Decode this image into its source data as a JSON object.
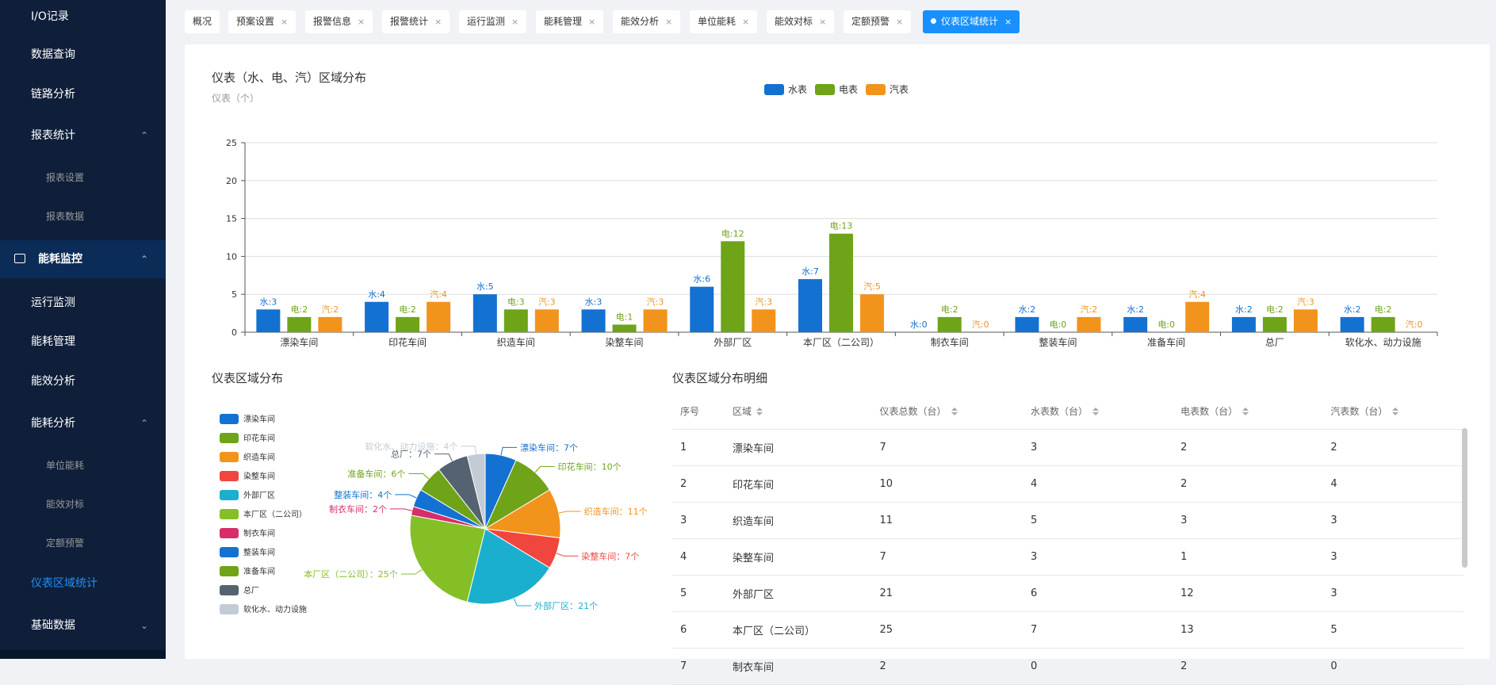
{
  "sidebar": {
    "items": [
      {
        "label": "I/O记录",
        "kind": "top"
      },
      {
        "label": "数据查询",
        "kind": "top"
      },
      {
        "label": "链路分析",
        "kind": "top"
      },
      {
        "label": "报表统计",
        "kind": "top",
        "chevron": "⌃"
      },
      {
        "label": "报表设置",
        "kind": "sub"
      },
      {
        "label": "报表数据",
        "kind": "sub"
      },
      {
        "label": "能耗监控",
        "kind": "group",
        "chevron": "⌃"
      },
      {
        "label": "运行监测",
        "kind": "top"
      },
      {
        "label": "能耗管理",
        "kind": "top"
      },
      {
        "label": "能效分析",
        "kind": "top"
      },
      {
        "label": "能耗分析",
        "kind": "top",
        "chevron": "⌃"
      },
      {
        "label": "单位能耗",
        "kind": "sub"
      },
      {
        "label": "能效对标",
        "kind": "sub"
      },
      {
        "label": "定额预警",
        "kind": "sub"
      },
      {
        "label": "仪表区域统计",
        "kind": "current"
      },
      {
        "label": "基础数据",
        "kind": "top",
        "chevron": "⌄"
      }
    ]
  },
  "tabs": [
    {
      "label": "概况",
      "closable": false
    },
    {
      "label": "预案设置",
      "closable": true
    },
    {
      "label": "报警信息",
      "closable": true
    },
    {
      "label": "报警统计",
      "closable": true
    },
    {
      "label": "运行监测",
      "closable": true
    },
    {
      "label": "能耗管理",
      "closable": true
    },
    {
      "label": "能效分析",
      "closable": true
    },
    {
      "label": "单位能耗",
      "closable": true
    },
    {
      "label": "能效对标",
      "closable": true
    },
    {
      "label": "定额预警",
      "closable": true
    },
    {
      "label": "仪表区域统计",
      "closable": true,
      "active": true
    }
  ],
  "tab_close_glyph": "×",
  "bar_section": {
    "title": "仪表（水、电、汽）区域分布",
    "subtitle": "仪表（个）"
  },
  "pie_section": {
    "title": "仪表区域分布"
  },
  "table_section": {
    "title": "仪表区域分布明细"
  },
  "colors": {
    "water": "#1371d1",
    "electric": "#6fa318",
    "steam": "#f2931c",
    "accent": "#1890ff",
    "sidebar_bg": "#0f1f3a"
  },
  "chart_data": [
    {
      "type": "bar",
      "title": "仪表（水、电、汽）区域分布",
      "ylabel": "仪表（个）",
      "ylim": [
        0,
        25
      ],
      "yticks": [
        0,
        5,
        10,
        15,
        20,
        25
      ],
      "grid": true,
      "legend_position": "top-center",
      "categories": [
        "漂染车间",
        "印花车间",
        "织造车间",
        "染整车间",
        "外部厂区",
        "本厂区（二公司）",
        "制衣车间",
        "整装车间",
        "准备车间",
        "总厂",
        "软化水、动力设施"
      ],
      "series": [
        {
          "name": "水表",
          "prefix": "水:",
          "color": "#1371d1",
          "values": [
            3,
            4,
            5,
            3,
            6,
            7,
            0,
            2,
            2,
            2,
            2
          ]
        },
        {
          "name": "电表",
          "prefix": "电:",
          "color": "#6fa318",
          "values": [
            2,
            2,
            3,
            1,
            12,
            13,
            2,
            0,
            0,
            2,
            2
          ]
        },
        {
          "name": "汽表",
          "prefix": "汽:",
          "color": "#f2931c",
          "values": [
            2,
            4,
            3,
            3,
            3,
            5,
            0,
            2,
            4,
            3,
            0
          ]
        }
      ]
    },
    {
      "type": "pie",
      "title": "仪表区域分布",
      "legend_position": "left",
      "unit": "个",
      "slices": [
        {
          "name": "漂染车间",
          "value": 7,
          "color": "#1371d1"
        },
        {
          "name": "印花车间",
          "value": 10,
          "color": "#6fa318"
        },
        {
          "name": "织造车间",
          "value": 11,
          "color": "#f2931c"
        },
        {
          "name": "染整车间",
          "value": 7,
          "color": "#f0463e"
        },
        {
          "name": "外部厂区",
          "value": 21,
          "color": "#1aafcf"
        },
        {
          "name": "本厂区（二公司）",
          "value": 25,
          "color": "#85bf26"
        },
        {
          "name": "制衣车间",
          "value": 2,
          "color": "#d72d6b"
        },
        {
          "name": "整装车间",
          "value": 4,
          "color": "#1371d1"
        },
        {
          "name": "准备车间",
          "value": 6,
          "color": "#6fa318"
        },
        {
          "name": "总厂",
          "value": 7,
          "color": "#556270"
        },
        {
          "name": "软化水、动力设施",
          "value": 4,
          "color": "#c3ccd6"
        }
      ]
    }
  ],
  "table": {
    "headers": [
      "序号",
      "区域",
      "仪表总数（台）",
      "水表数（台）",
      "电表数（台）",
      "汽表数（台）"
    ],
    "rows": [
      [
        "1",
        "漂染车间",
        "7",
        "3",
        "2",
        "2"
      ],
      [
        "2",
        "印花车间",
        "10",
        "4",
        "2",
        "4"
      ],
      [
        "3",
        "织造车间",
        "11",
        "5",
        "3",
        "3"
      ],
      [
        "4",
        "染整车间",
        "7",
        "3",
        "1",
        "3"
      ],
      [
        "5",
        "外部厂区",
        "21",
        "6",
        "12",
        "3"
      ],
      [
        "6",
        "本厂区（二公司）",
        "25",
        "7",
        "13",
        "5"
      ],
      [
        "7",
        "制衣车间",
        "2",
        "0",
        "2",
        "0"
      ]
    ]
  }
}
